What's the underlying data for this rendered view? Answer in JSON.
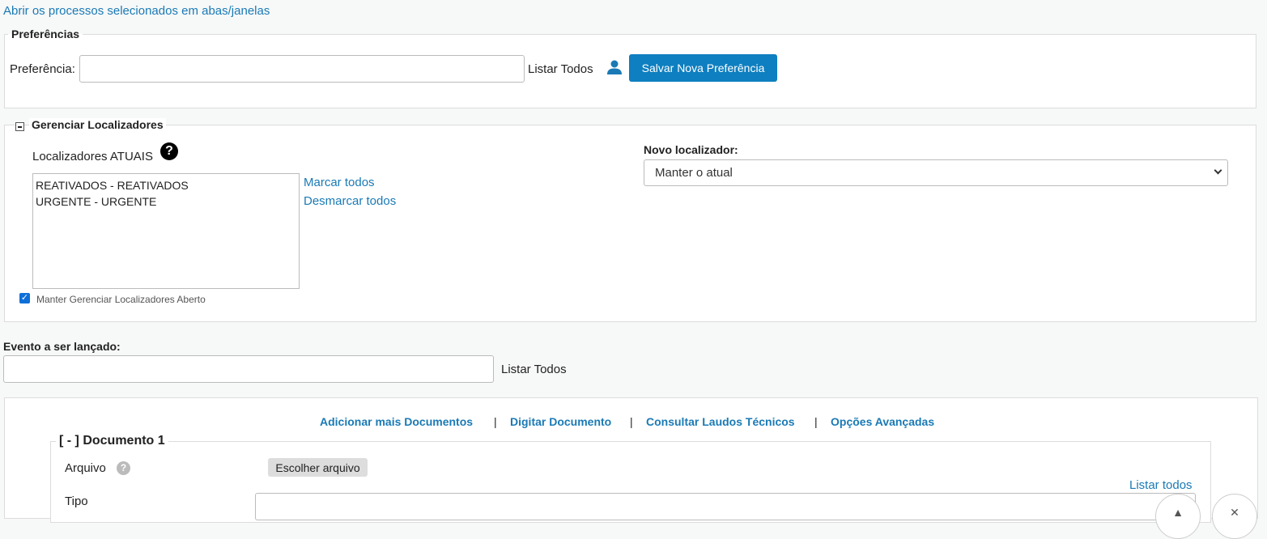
{
  "top_link": "Abrir os processos selecionados em abas/janelas",
  "preferencias": {
    "legend": "Preferências",
    "label": "Preferência:",
    "input_value": "",
    "listar_label": "Listar Todos",
    "save_label": "Salvar Nova Preferência"
  },
  "localizadores": {
    "title": "Gerenciar Localizadores",
    "atuais_label": "Localizadores ATUAIS",
    "help_glyph": "?",
    "items": [
      "REATIVADOS - REATIVADOS",
      "URGENTE - URGENTE"
    ],
    "marcar_todos": "Marcar todos",
    "desmarcar_todos": "Desmarcar todos",
    "keep_open_label": "Manter Gerenciar Localizadores Aberto",
    "keep_open_checked": true,
    "novo_label": "Novo localizador:",
    "novo_selected": "Manter o atual"
  },
  "evento": {
    "label": "Evento a ser lançado:",
    "input_value": "",
    "listar_label": "Listar Todos"
  },
  "documentos": {
    "actions": [
      "Adicionar mais Documentos",
      "Digitar Documento",
      "Consultar Laudos Técnicos",
      "Opções Avançadas"
    ],
    "separator": "|",
    "doc_legend": "[ - ] Documento 1",
    "arquivo_label": "Arquivo",
    "file_button": "Escolher arquivo",
    "listar_todos": "Listar todos",
    "tipo_label": "Tipo",
    "tipo_value": ""
  },
  "colors": {
    "link": "#1a7ab5",
    "primary_button": "#0e7fc0"
  },
  "icons": {
    "user": "user-icon",
    "help": "help-icon",
    "collapse": "collapse-minus-icon"
  }
}
